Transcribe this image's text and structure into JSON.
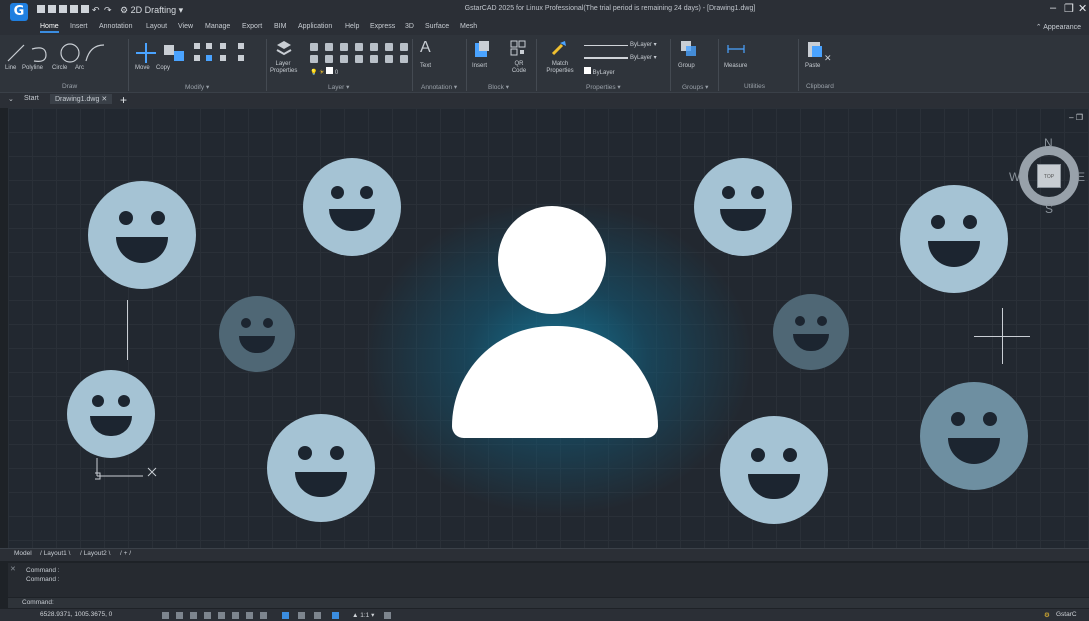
{
  "app": {
    "workspace": "2D Drafting",
    "window_title": "GstarCAD 2025 for Linux Professional(The trial period is remaining 24 days) - [Drawing1.dwg]",
    "appearance_label": "Appearance"
  },
  "menu": [
    "Home",
    "Insert",
    "Annotation",
    "Layout",
    "View",
    "Manage",
    "Export",
    "BIM",
    "Application",
    "Help",
    "Express",
    "3D",
    "Surface",
    "Mesh"
  ],
  "ribbon": {
    "draw": {
      "line": "Line",
      "polyline": "Polyline",
      "circle": "Circle",
      "arc": "Arc",
      "label": "Draw"
    },
    "modify": {
      "move": "Move",
      "copy": "Copy",
      "label": "Modify"
    },
    "layer": {
      "properties": "Layer Properties",
      "current": "0",
      "label": "Layer"
    },
    "annotation": {
      "text": "Text",
      "label": "Annotation"
    },
    "block": {
      "insert": "Insert",
      "qr": "QR Code",
      "label": "Block"
    },
    "properties": {
      "match": "Match Properties",
      "bylayer1": "ByLayer",
      "bylayer2": "ByLayer",
      "bylayer3": "ByLayer",
      "label": "Properties"
    },
    "groups": {
      "group": "Group",
      "label": "Groups"
    },
    "utilities": {
      "measure": "Measure",
      "label": "Utilities"
    },
    "clipboard": {
      "paste": "Paste",
      "label": "Clipboard"
    }
  },
  "doc_tabs": {
    "start": "Start",
    "drawing": "Drawing1.dwg"
  },
  "compass": {
    "n": "N",
    "s": "S",
    "e": "E",
    "w": "W",
    "top": "TOP"
  },
  "layout_tabs": [
    "Model",
    "Layout1",
    "Layout2",
    "+"
  ],
  "command": {
    "history": [
      "Command :",
      "Command :"
    ],
    "prompt": "Command:"
  },
  "status": {
    "coords": "6528.9371, 1005.3675, 0",
    "scale": "1:1",
    "product": "GstarC"
  }
}
